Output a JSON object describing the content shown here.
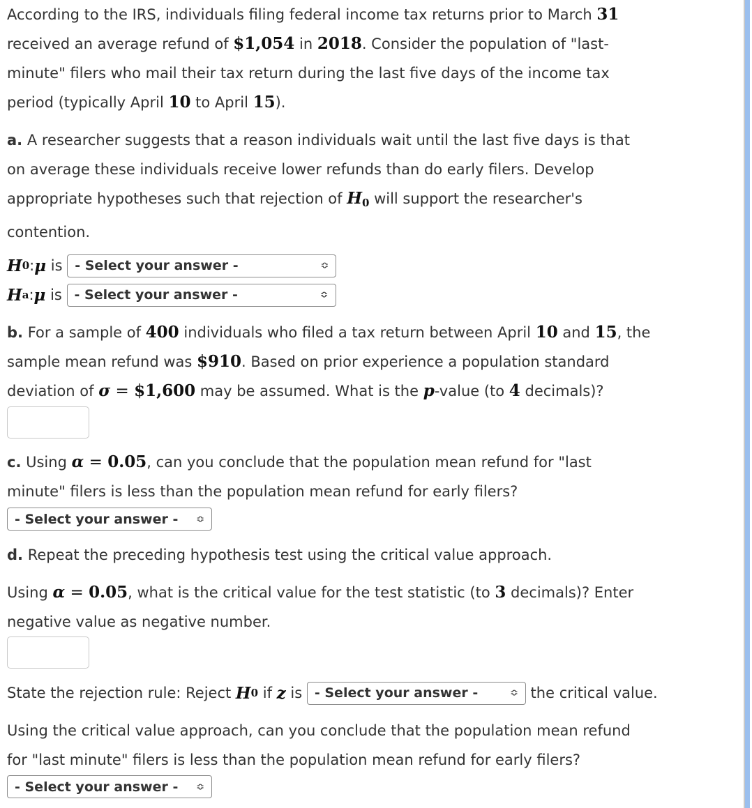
{
  "intro": {
    "t1": "According to the IRS, individuals filing federal income tax returns prior to March ",
    "march_day": "31",
    "t2": "received an average refund of ",
    "refund": "$1,054",
    "t3": " in ",
    "year": "2018",
    "t4": ". Consider the population of \"last-",
    "t5": "minute\" filers who mail their tax return during the last five days of the income tax",
    "t6": "period (typically April ",
    "day1": "10",
    "t7": " to April ",
    "day2": "15",
    "t8": ")."
  },
  "part_a": {
    "label": "a.",
    "line1": " A researcher suggests that a reason individuals wait until the last five days is that",
    "line2": "on average these individuals receive lower refunds than do early filers. Develop",
    "line3a": "appropriate hypotheses such that rejection of ",
    "line3b": " will support the researcher's",
    "line4": "contention.",
    "h0_sym": "H",
    "h0_sub": "0",
    "ha_sub": "a",
    "mu": "μ",
    "is": " is ",
    "colon": ": ",
    "h0_select": "- Select your answer -",
    "ha_select": "- Select your answer -"
  },
  "part_b": {
    "label": "b.",
    "t1": " For a sample of ",
    "n": "400",
    "t2": " individuals who filed a tax return between April ",
    "d1": "10",
    "t3": " and ",
    "d2": "15",
    "t4": ", the",
    "t5": "sample mean refund was ",
    "mean": "$910",
    "t6": ". Based on prior experience a population standard",
    "t7": "deviation of ",
    "sigma": "σ",
    "eq": " = ",
    "sd": "$1,600",
    "t8": " may be assumed. What is the ",
    "p": "p",
    "t9": "-value (to ",
    "dec": "4",
    "t10": " decimals)?",
    "answer": ""
  },
  "part_c": {
    "label": "c.",
    "t1": " Using ",
    "alpha": "α",
    "eq": " = ",
    "alpha_val": "0.05",
    "t2": ", can you conclude that the population mean refund for \"last",
    "t3": "minute\" filers is less than the population mean refund for early filers?",
    "select": "- Select your answer -"
  },
  "part_d": {
    "label": "d.",
    "t1": " Repeat the preceding hypothesis test using the critical value approach.",
    "t2": "Using ",
    "alpha": "α",
    "eq": " = ",
    "alpha_val": "0.05",
    "t3": ", what is the critical value for the test statistic (to ",
    "dec": "3",
    "t4": " decimals)? Enter",
    "t5": "negative value as negative number.",
    "answer": "",
    "rule1": "State the rejection rule: Reject ",
    "rule2": " if ",
    "z": "z",
    "rule3": " is ",
    "rule_select": "- Select your answer -",
    "rule4": " the critical value.",
    "q1": "Using the critical value approach, can you conclude that the population mean refund",
    "q2": "for \"last minute\" filers is less than the population mean refund for early filers?",
    "conclude_select": "- Select your answer -"
  },
  "icons": {
    "select_chevron": "≎"
  }
}
